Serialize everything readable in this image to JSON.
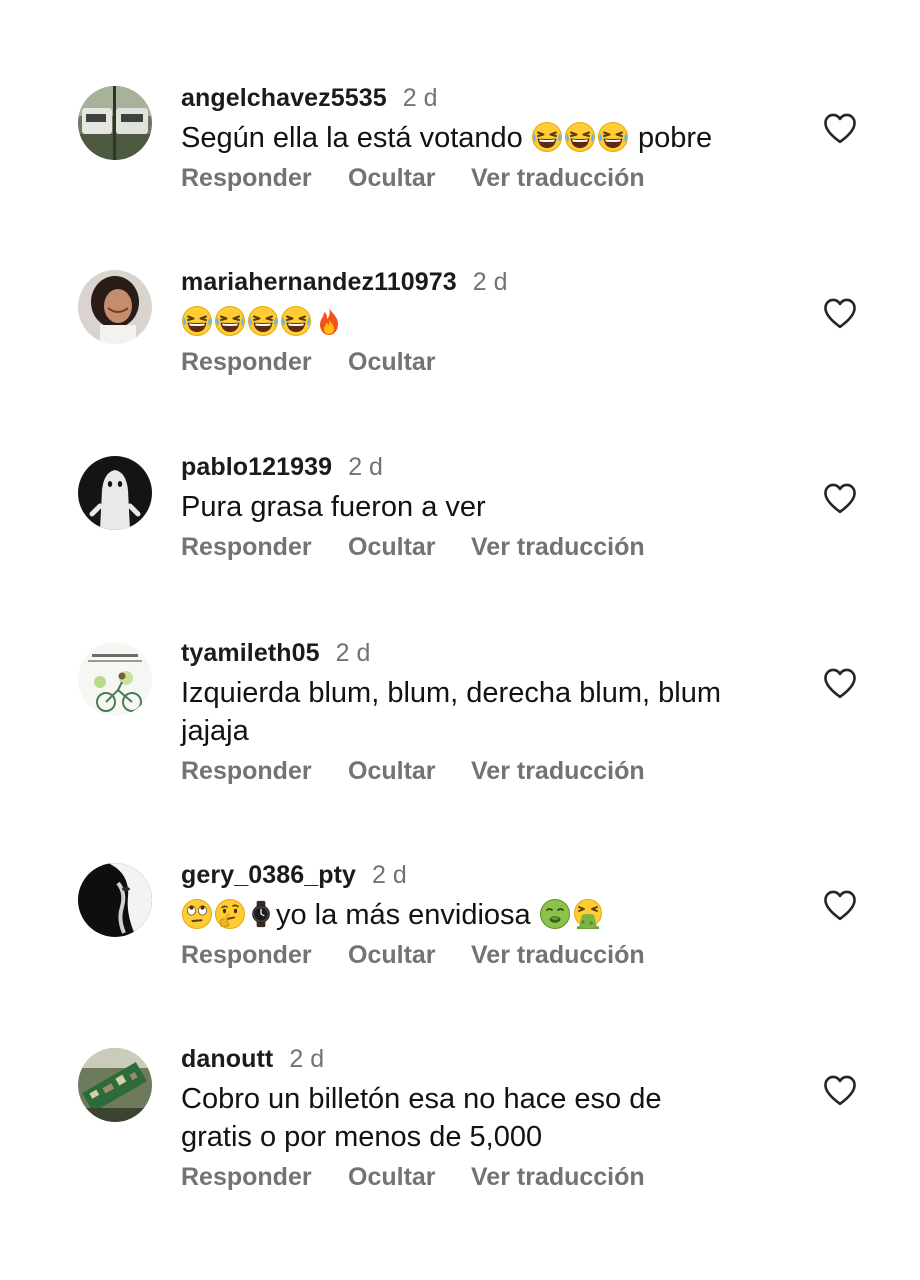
{
  "actions": {
    "reply": "Responder",
    "hide": "Ocultar",
    "translate": "Ver traducción"
  },
  "icons": {
    "like": "heart-outline-icon"
  },
  "colors": {
    "username": "#1b1b1b",
    "secondary_text": "#737373",
    "body_text": "#121212"
  },
  "comments": [
    {
      "username": "angelchavez5535",
      "time": "2 d",
      "text_before": "Según ella la está votando",
      "emojis": [
        "laughing-face",
        "laughing-face",
        "laughing-face"
      ],
      "text_after": "pobre",
      "has_translate": true
    },
    {
      "username": "mariahernandez110973",
      "time": "2 d",
      "emojis": [
        "laughing-face",
        "laughing-face",
        "laughing-face",
        "laughing-face",
        "fire"
      ],
      "has_translate": false
    },
    {
      "username": "pablo121939",
      "time": "2 d",
      "text": "Pura grasa fueron a ver",
      "has_translate": true
    },
    {
      "username": "tyamileth05",
      "time": "2 d",
      "text_line1": "Izquierda blum, blum, derecha blum, blum",
      "text_line2": "jajaja",
      "has_translate": true
    },
    {
      "username": "gery_0386_pty",
      "time": "2 d",
      "emojis_before": [
        "eye-roll-face",
        "thinking-face",
        "wristwatch"
      ],
      "text": "yo la más envidiosa",
      "emojis_after": [
        "nauseated-face",
        "vomiting-face"
      ],
      "has_translate": true
    },
    {
      "username": "danoutt",
      "time": "2 d",
      "text_line1": "Cobro un billetón esa no hace eso de",
      "text_line2": "gratis o por menos de 5,000",
      "has_translate": true
    }
  ]
}
